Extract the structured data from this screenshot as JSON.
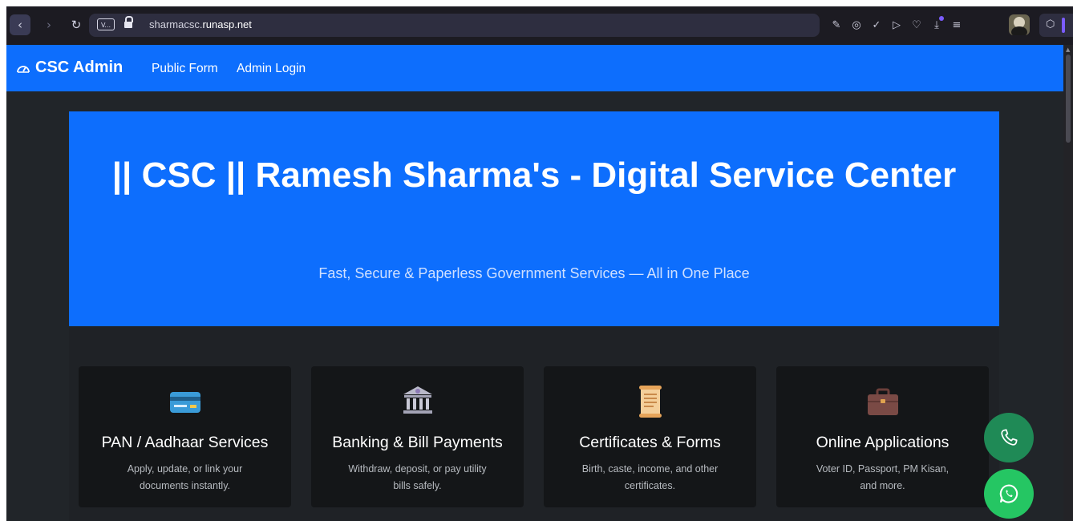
{
  "browser": {
    "url_host": "sharmacsc.",
    "url_domain": "runasp.net",
    "tab_icon_label": "V...",
    "accent": "#7b5cff"
  },
  "site_nav": {
    "brand": "CSC Admin",
    "links": [
      "Public Form",
      "Admin Login"
    ],
    "color": "#0d6efd"
  },
  "hero": {
    "title": "|| CSC || Ramesh Sharma's - Digital Service Center",
    "subtitle": "Fast, Secure & Paperless Government Services — All in One Place"
  },
  "cards": [
    {
      "icon": "credit-card-icon",
      "title": "PAN / Aadhaar Services",
      "desc": "Apply, update, or link your documents instantly."
    },
    {
      "icon": "bank-icon",
      "title": "Banking & Bill Payments",
      "desc": "Withdraw, deposit, or pay utility bills safely."
    },
    {
      "icon": "scroll-icon",
      "title": "Certificates & Forms",
      "desc": "Birth, caste, income, and other certificates."
    },
    {
      "icon": "briefcase-icon",
      "title": "Online Applications",
      "desc": "Voter ID, Passport, PM Kisan, and more."
    }
  ],
  "floating": {
    "phone_color": "#1f8a56",
    "whatsapp_color": "#25c663"
  }
}
